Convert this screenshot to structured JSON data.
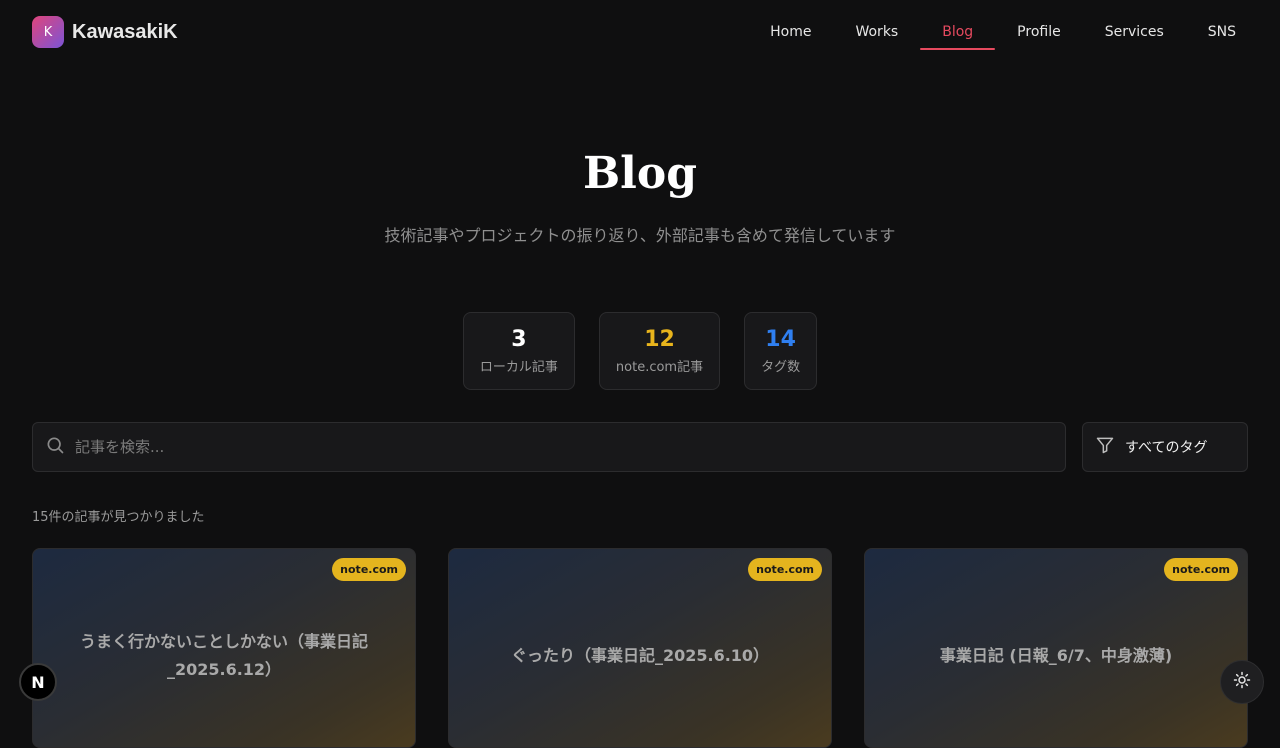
{
  "brand": {
    "logo_letter": "K",
    "name": "KawasakiK"
  },
  "nav": {
    "items": [
      {
        "label": "Home"
      },
      {
        "label": "Works"
      },
      {
        "label": "Blog",
        "active": true
      },
      {
        "label": "Profile"
      },
      {
        "label": "Services"
      },
      {
        "label": "SNS"
      }
    ]
  },
  "hero": {
    "title": "Blog",
    "subtitle": "技術記事やプロジェクトの振り返り、外部記事も含めて発信しています"
  },
  "stats": [
    {
      "value": "3",
      "label": "ローカル記事",
      "color": "#ffffff"
    },
    {
      "value": "12",
      "label": "note.com記事",
      "color": "#e8b41c"
    },
    {
      "value": "14",
      "label": "タグ数",
      "color": "#2f7ff0"
    }
  ],
  "search": {
    "placeholder": "記事を検索...",
    "value": "",
    "icon": "search-icon"
  },
  "tag_filter": {
    "label": "すべてのタグ",
    "icon": "filter-icon"
  },
  "result_count": "15件の記事が見つかりました",
  "cards": [
    {
      "badge": "note.com",
      "title": "うまく行かないことしかない（事業日記_2025.6.12）"
    },
    {
      "badge": "note.com",
      "title": "ぐったり（事業日記_2025.6.10）"
    },
    {
      "badge": "note.com",
      "title": "事業日記 (日報_6/7、中身激薄)"
    }
  ],
  "fab_left": {
    "label": "N"
  },
  "fab_right": {
    "icon": "sun-icon"
  },
  "colors": {
    "accent": "#e64a5f",
    "badge": "#e4b41e",
    "background": "#0f0f10"
  }
}
